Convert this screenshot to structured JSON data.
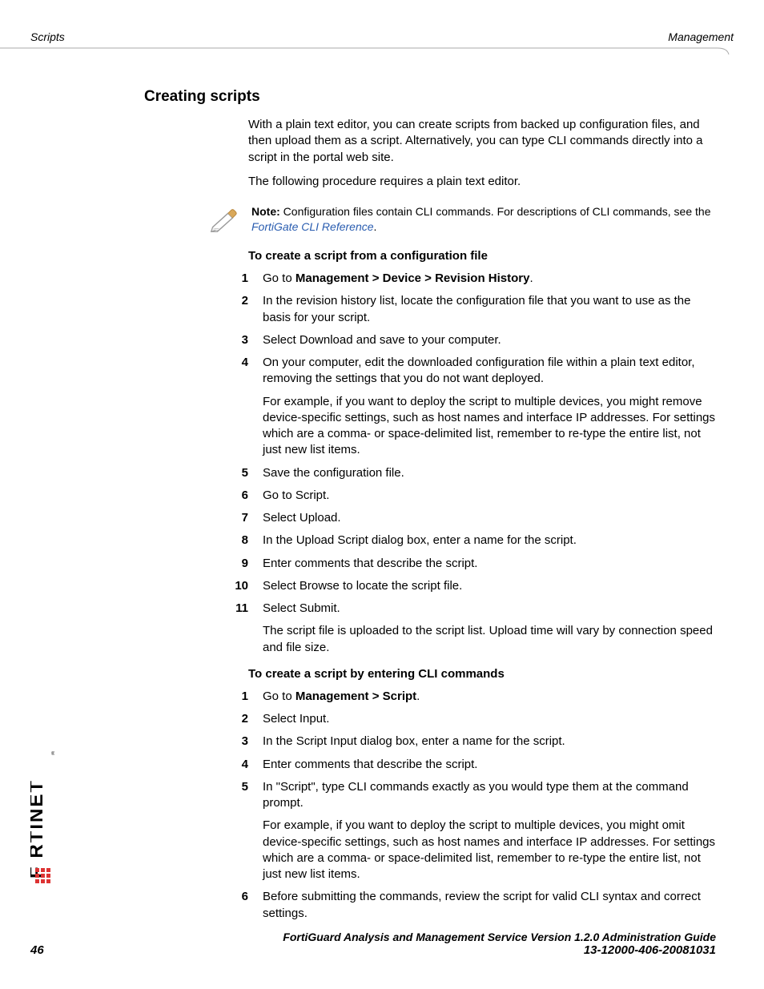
{
  "header": {
    "left": "Scripts",
    "right": "Management"
  },
  "section_title": "Creating scripts",
  "intro": {
    "p1": "With a plain text editor, you can create scripts from backed up configuration files, and then upload them as a script. Alternatively, you can type CLI commands directly into a script in the portal web site.",
    "p2": "The following procedure requires a plain text editor."
  },
  "note": {
    "label": "Note:",
    "text_before_link": " Configuration files contain CLI commands. For descriptions of CLI commands, see the ",
    "link_text": "FortiGate CLI Reference",
    "text_after_link": "."
  },
  "proc1": {
    "heading": "To create a script from a configuration file",
    "steps": [
      {
        "num": "1",
        "paras": [
          {
            "t": "Go to ",
            "b": "Management > Device > Revision History",
            "after": "."
          }
        ]
      },
      {
        "num": "2",
        "paras": [
          {
            "t": "In the revision history list, locate the configuration file that you want to use as the basis for your script."
          }
        ]
      },
      {
        "num": "3",
        "paras": [
          {
            "t": "Select Download and save to your computer."
          }
        ]
      },
      {
        "num": "4",
        "paras": [
          {
            "t": "On your computer, edit the downloaded configuration file within a plain text editor, removing the settings that you do not want deployed."
          },
          {
            "t": "For example, if you want to deploy the script to multiple devices, you might remove device-specific settings, such as host names and interface IP addresses. For settings which are a comma- or space-delimited list, remember to re-type the entire list, not just new list items."
          }
        ]
      },
      {
        "num": "5",
        "paras": [
          {
            "t": "Save the configuration file."
          }
        ]
      },
      {
        "num": "6",
        "paras": [
          {
            "t": "Go to Script."
          }
        ]
      },
      {
        "num": "7",
        "paras": [
          {
            "t": "Select Upload."
          }
        ]
      },
      {
        "num": "8",
        "paras": [
          {
            "t": "In the Upload Script dialog box, enter a name for the script."
          }
        ]
      },
      {
        "num": "9",
        "paras": [
          {
            "t": "Enter comments that describe the script."
          }
        ]
      },
      {
        "num": "10",
        "paras": [
          {
            "t": "Select Browse to locate the script file."
          }
        ]
      },
      {
        "num": "11",
        "paras": [
          {
            "t": "Select Submit."
          },
          {
            "t": "The script file is uploaded to the script list. Upload time will vary by connection speed and file size."
          }
        ]
      }
    ]
  },
  "proc2": {
    "heading": "To create a script by entering CLI commands",
    "steps": [
      {
        "num": "1",
        "paras": [
          {
            "t": "Go to ",
            "b": "Management > Script",
            "after": "."
          }
        ]
      },
      {
        "num": "2",
        "paras": [
          {
            "t": "Select Input."
          }
        ]
      },
      {
        "num": "3",
        "paras": [
          {
            "t": "In the Script Input dialog box, enter a name for the script."
          }
        ]
      },
      {
        "num": "4",
        "paras": [
          {
            "t": "Enter comments that describe the script."
          }
        ]
      },
      {
        "num": "5",
        "paras": [
          {
            "t": "In \"Script\", type CLI commands exactly as you would type them at the command prompt."
          },
          {
            "t": "For example, if you want to deploy the script to multiple devices, you might omit device-specific settings, such as host names and interface IP addresses. For settings which are a comma- or space-delimited list, remember to re-type the entire list, not just new list items."
          }
        ]
      },
      {
        "num": "6",
        "paras": [
          {
            "t": "Before submitting the commands, review the script for valid CLI syntax and correct settings."
          }
        ]
      }
    ]
  },
  "footer": {
    "line1": "FortiGuard Analysis and Management Service Version 1.2.0 Administration Guide",
    "page": "46",
    "doc": "13-12000-406-20081031"
  }
}
